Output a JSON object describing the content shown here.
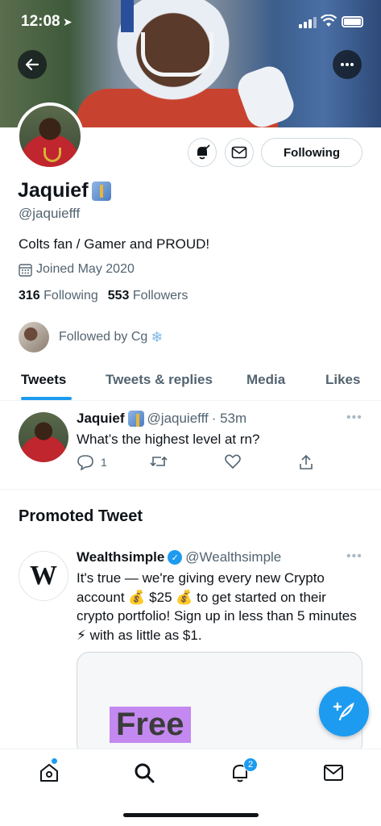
{
  "status_bar": {
    "time": "12:08"
  },
  "profile": {
    "name": "Jaquief",
    "handle": "@jaquiefff",
    "bio": "Colts fan / Gamer and PROUD!",
    "joined": "Joined May 2020",
    "following_count": "316",
    "following_label": "Following",
    "followers_count": "553",
    "followers_label": "Followers",
    "followed_by": "Followed by Cg",
    "follow_button_label": "Following"
  },
  "tabs": [
    "Tweets",
    "Tweets & replies",
    "Media",
    "Likes"
  ],
  "tweet": {
    "name": "Jaquief",
    "handle": "@jaquiefff",
    "time": "· 53m",
    "text": "What’s the highest level at rn?",
    "reply_count": "1"
  },
  "promoted": {
    "header": "Promoted Tweet",
    "name": "Wealthsimple",
    "handle": "@Wealthsimple",
    "avatar_letter": "W",
    "text": "It's true — we're giving every new Crypto account 💰 $25 💰  to get started on their crypto portfolio! Sign up in less than 5 minutes ⚡  with as little as $1.",
    "card_text": "Free"
  },
  "bottom_nav": {
    "notifications_badge": "2"
  },
  "colors": {
    "accent": "#1d9bf0",
    "text": "#0f1419",
    "secondary": "#536471"
  }
}
